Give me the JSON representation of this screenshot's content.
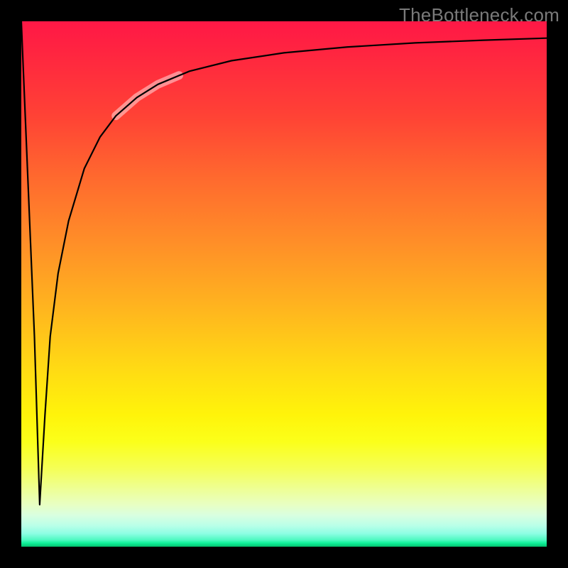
{
  "attribution": "TheBottleneck.com",
  "colors": {
    "page_bg": "#000000",
    "curve_stroke": "#000000",
    "highlight_stroke": "rgba(255,220,220,0.55)",
    "gradient": [
      "#ff1846",
      "#ff2540",
      "#ff4235",
      "#ff6a2e",
      "#ff8e28",
      "#ffb31f",
      "#ffda14",
      "#fff40a",
      "#fbff1a",
      "#f5ff55",
      "#eeff95",
      "#e8ffc3",
      "#d9ffe0",
      "#b9ffe8",
      "#8dfee3",
      "#4ff9c1",
      "#0ff29a",
      "#04c16f"
    ]
  },
  "chart_data": {
    "type": "line",
    "title": "",
    "xlabel": "",
    "ylabel": "",
    "xlim": [
      0,
      100
    ],
    "ylim": [
      0,
      100
    ],
    "grid": false,
    "legend": null,
    "series": [
      {
        "name": "bottleneck-curve",
        "x": [
          0,
          2.5,
          3.5,
          4.5,
          5.5,
          7,
          9,
          12,
          15,
          18,
          22,
          26,
          32,
          40,
          50,
          62,
          75,
          88,
          100
        ],
        "y": [
          100,
          40,
          8,
          25,
          40,
          52,
          62,
          72,
          78,
          82,
          85.5,
          88,
          90.5,
          92.5,
          94,
          95.1,
          95.9,
          96.4,
          96.8
        ]
      },
      {
        "name": "highlight-segment",
        "x": [
          18,
          22,
          26,
          30
        ],
        "y": [
          82,
          85.5,
          88,
          89.7
        ]
      }
    ],
    "notes": "Vertical gradient from red (top) through orange/yellow to green (bottom). Single black curve with a narrow sharp dip near x≈3.5 then asymptotic rise toward ~97. A short pale/rose semi-transparent thick stroke overlays the curve around x≈18–30."
  }
}
